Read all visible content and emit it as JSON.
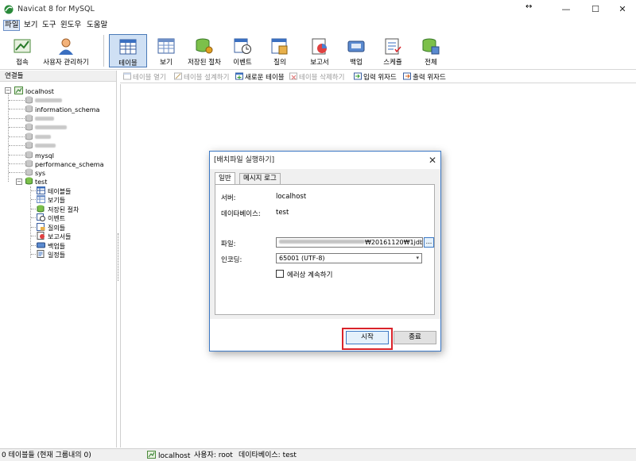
{
  "window": {
    "title": "Navicat 8 for MySQL",
    "minimize": "—",
    "maximize": "☐",
    "close": "✕",
    "resize_cursor": "↔"
  },
  "menu": [
    "파일",
    "보기",
    "도구",
    "윈도우",
    "도움말"
  ],
  "toolbar": {
    "items": [
      {
        "label": "접속",
        "icon": "connection-icon"
      },
      {
        "label": "사용자 관리하기",
        "icon": "user-manager-icon"
      },
      {
        "label": "테이블",
        "icon": "table-icon",
        "pressed": true
      },
      {
        "label": "보기",
        "icon": "view-icon"
      },
      {
        "label": "저장된 절차",
        "icon": "stored-procedure-icon"
      },
      {
        "label": "이벤트",
        "icon": "event-icon"
      },
      {
        "label": "질의",
        "icon": "query-icon"
      },
      {
        "label": "보고서",
        "icon": "report-icon"
      },
      {
        "label": "백업",
        "icon": "backup-icon"
      },
      {
        "label": "스케쥴",
        "icon": "schedule-icon"
      },
      {
        "label": "전체",
        "icon": "all-icon"
      }
    ]
  },
  "leftpanel": {
    "header": "연결들",
    "connection": "localhost",
    "databases": [
      "information_schema",
      "mysql",
      "performance_schema",
      "sys",
      "test"
    ],
    "test_children": [
      "테이블들",
      "보기들",
      "저장된 절차",
      "이벤트",
      "질의들",
      "보고서들",
      "백업들",
      "일정들"
    ]
  },
  "subtoolbar": {
    "open_table": "테이블 열기",
    "design_table": "테이블 설계하기",
    "new_table": "새로운 테이블",
    "delete_table": "테이블 삭제하기",
    "import_wizard": "입력 위자드",
    "export_wizard": "출력 위자드"
  },
  "dialog": {
    "title": "[배치파일 실행하기]",
    "close": "✕",
    "tabs": [
      "일반",
      "메시지 로그"
    ],
    "server_label": "서버:",
    "server_value": "localhost",
    "database_label": "데이타베이스:",
    "database_value": "test",
    "file_label": "파일:",
    "file_value_suffix": "₩20161120₩1jdb",
    "browse": "...",
    "encoding_label": "인코딩:",
    "encoding_value": "65001 (UTF-8)",
    "continue_on_error": "에러상 계속하기",
    "start_button": "시작",
    "end_button": "종료"
  },
  "statusbar": {
    "table_count": "0 테이블들 (현재 그룹내의 0)",
    "connection": "localhost",
    "user": "사용자: root",
    "database": "데이타베이스: test"
  },
  "colors": {
    "accent": "#3c78c4",
    "highlight": "#d9232a",
    "pressed_bg": "#cfe0f4"
  }
}
